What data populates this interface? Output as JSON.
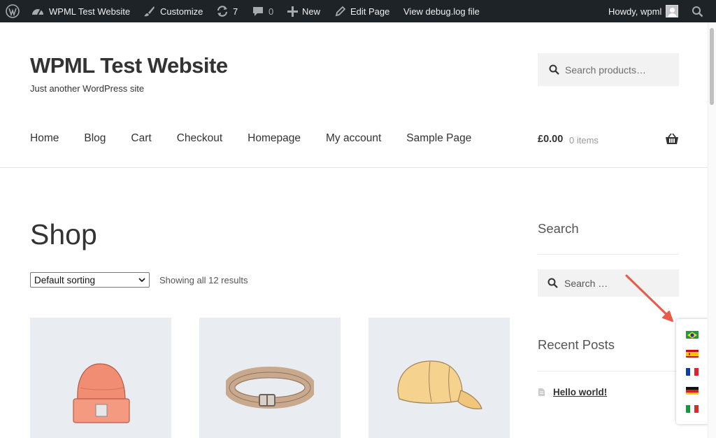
{
  "admin_bar": {
    "site_name": "WPML Test Website",
    "customize": "Customize",
    "updates_count": "7",
    "comments_count": "0",
    "new_label": "New",
    "edit_page": "Edit Page",
    "debug_log": "View debug.log file",
    "howdy": "Howdy, wpml",
    "icons": [
      "wordpress-icon",
      "dashboard-icon",
      "brush-icon",
      "updates-icon",
      "comment-icon",
      "plus-icon",
      "pencil-icon",
      "avatar",
      "search-icon"
    ]
  },
  "header": {
    "site_title": "WPML Test Website",
    "tagline": "Just another WordPress site",
    "search_placeholder": "Search products…"
  },
  "nav": {
    "items": [
      "Home",
      "Blog",
      "Cart",
      "Checkout",
      "Homepage",
      "My account",
      "Sample Page"
    ]
  },
  "cart": {
    "total": "£0.00",
    "count": "0 items"
  },
  "shop": {
    "title": "Shop",
    "sort_selected": "Default sorting",
    "result_count": "Showing all 12 results",
    "products": [
      "beanie",
      "belt",
      "cap"
    ]
  },
  "sidebar": {
    "search_title": "Search",
    "search_placeholder": "Search …",
    "recent_posts_title": "Recent Posts",
    "recent_posts": [
      "Hello world!"
    ]
  },
  "language_switcher": {
    "flags": [
      "Brazil",
      "Spain",
      "France",
      "Germany",
      "Italy"
    ]
  },
  "colors": {
    "admin_bar_bg": "#1d2327",
    "arrow": "#e85b4a",
    "product_bg": "#e9edf1"
  }
}
